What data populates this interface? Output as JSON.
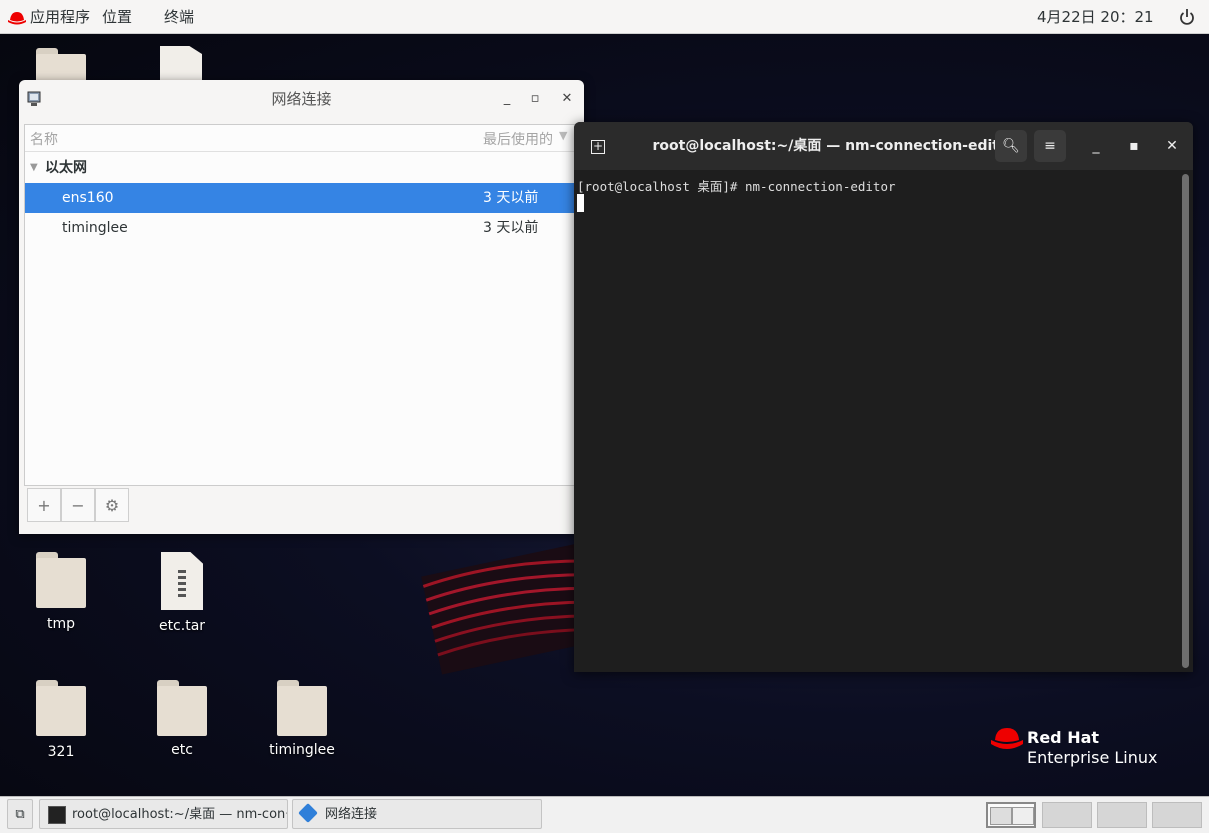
{
  "topbar": {
    "apps_label": "应用程序",
    "places_label": "位置",
    "terminal_label": "终端",
    "datetime": "4月22日  20：21"
  },
  "desktop_icons": [
    {
      "label": "tmp"
    },
    {
      "label": "etc.tar"
    },
    {
      "label": "321"
    },
    {
      "label": "etc"
    },
    {
      "label": "timinglee"
    }
  ],
  "nm_window": {
    "title": "网络连接",
    "col_name": "名称",
    "col_last_used": "最后使用的",
    "group": "以太网",
    "rows": [
      {
        "name": "ens160",
        "last_used": "3 天以前",
        "selected": true
      },
      {
        "name": "timinglee",
        "last_used": "3 天以前",
        "selected": false
      }
    ],
    "add_label": "+",
    "remove_label": "−"
  },
  "terminal": {
    "title": "root@localhost:~/桌面 — nm-connection-editor",
    "prompt_line": "[root@localhost 桌面]# nm-connection-editor"
  },
  "branding": {
    "line1": "Red Hat",
    "line2": "Enterprise Linux"
  },
  "taskbar": {
    "tasks": [
      {
        "label": "root@localhost:~/桌面 — nm-con···"
      },
      {
        "label": "网络连接"
      }
    ]
  },
  "colors": {
    "selection": "#3584e4",
    "redhat_red": "#ee0000",
    "terminal_bg": "#1e1e1e"
  }
}
